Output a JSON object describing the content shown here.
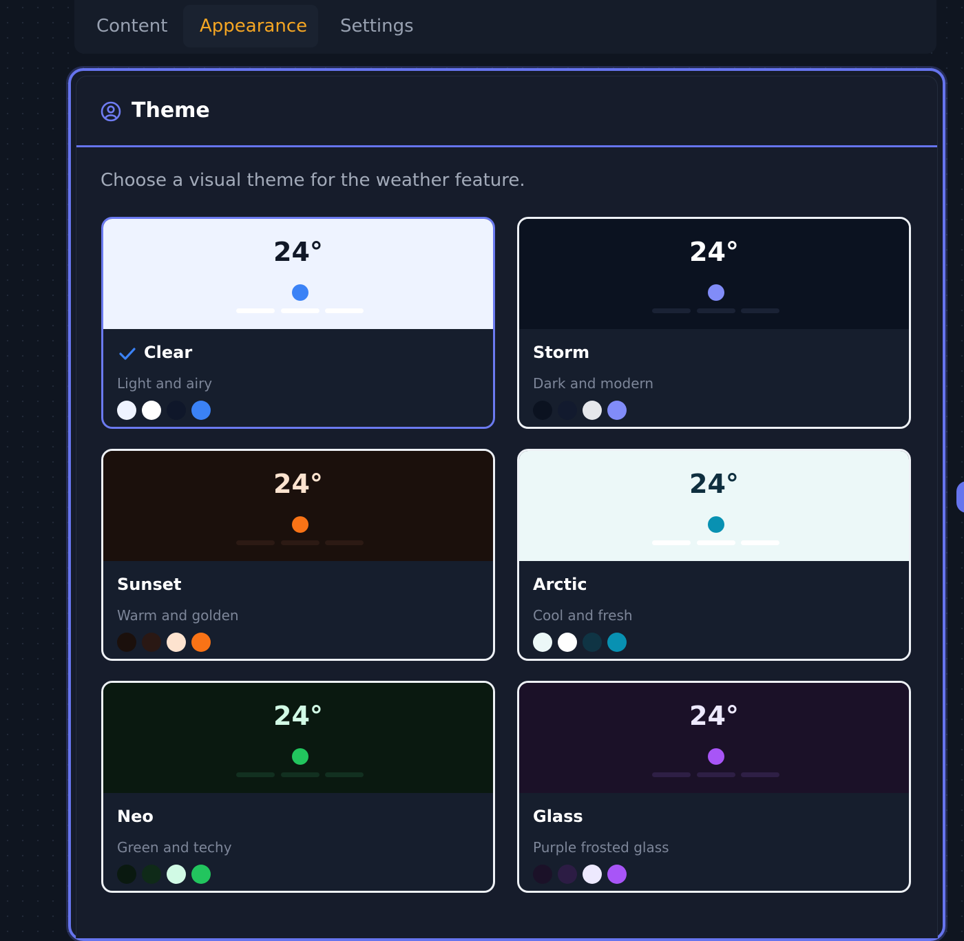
{
  "tabs": [
    {
      "label": "Content",
      "active": false
    },
    {
      "label": "Appearance",
      "active": true
    },
    {
      "label": "Settings",
      "active": false
    }
  ],
  "section": {
    "title": "Theme",
    "icon": "user-circle-icon",
    "description": "Choose a visual theme for the weather feature."
  },
  "themes": [
    {
      "name": "Clear",
      "description": "Light and airy",
      "temperature": "24°",
      "selected": true,
      "preview_bg": "#eef3ff",
      "temp_color": "#111827",
      "dot_color": "#3b82f6",
      "bar_color": "#ffffff",
      "swatches": [
        "#eef3ff",
        "#ffffff",
        "#0f172a",
        "#3b82f6"
      ]
    },
    {
      "name": "Storm",
      "description": "Dark and modern",
      "temperature": "24°",
      "selected": false,
      "preview_bg": "#0b1220",
      "temp_color": "#ffffff",
      "dot_color": "#818cf8",
      "bar_color": "#1a2235",
      "swatches": [
        "#0b1220",
        "#121a2e",
        "#e5e7eb",
        "#818cf8"
      ]
    },
    {
      "name": "Sunset",
      "description": "Warm and golden",
      "temperature": "24°",
      "selected": false,
      "preview_bg": "#1b100c",
      "temp_color": "#fde3cf",
      "dot_color": "#f97316",
      "bar_color": "#2c1a14",
      "swatches": [
        "#1b100c",
        "#2a1814",
        "#fde3cf",
        "#f97316"
      ]
    },
    {
      "name": "Arctic",
      "description": "Cool and fresh",
      "temperature": "24°",
      "selected": false,
      "preview_bg": "#ecf8f8",
      "temp_color": "#0f2f3f",
      "dot_color": "#0891b2",
      "bar_color": "#ffffff",
      "swatches": [
        "#ecf8f8",
        "#ffffff",
        "#0f3444",
        "#0891b2"
      ]
    },
    {
      "name": "Neo",
      "description": "Green and techy",
      "temperature": "24°",
      "selected": false,
      "preview_bg": "#0a1910",
      "temp_color": "#d1fae5",
      "dot_color": "#22c55e",
      "bar_color": "#123020",
      "swatches": [
        "#0a1910",
        "#0f2a18",
        "#d1fae5",
        "#22c55e"
      ]
    },
    {
      "name": "Glass",
      "description": "Purple frosted glass",
      "temperature": "24°",
      "selected": false,
      "preview_bg": "#1b1128",
      "temp_color": "#ede9fe",
      "dot_color": "#a855f7",
      "bar_color": "#2e1f45",
      "swatches": [
        "#1b1128",
        "#2c1c44",
        "#ede9fe",
        "#a855f7"
      ]
    }
  ],
  "colors": {
    "accent": "#6674ee",
    "active_tab": "#f5a623",
    "check": "#3b82f6"
  }
}
